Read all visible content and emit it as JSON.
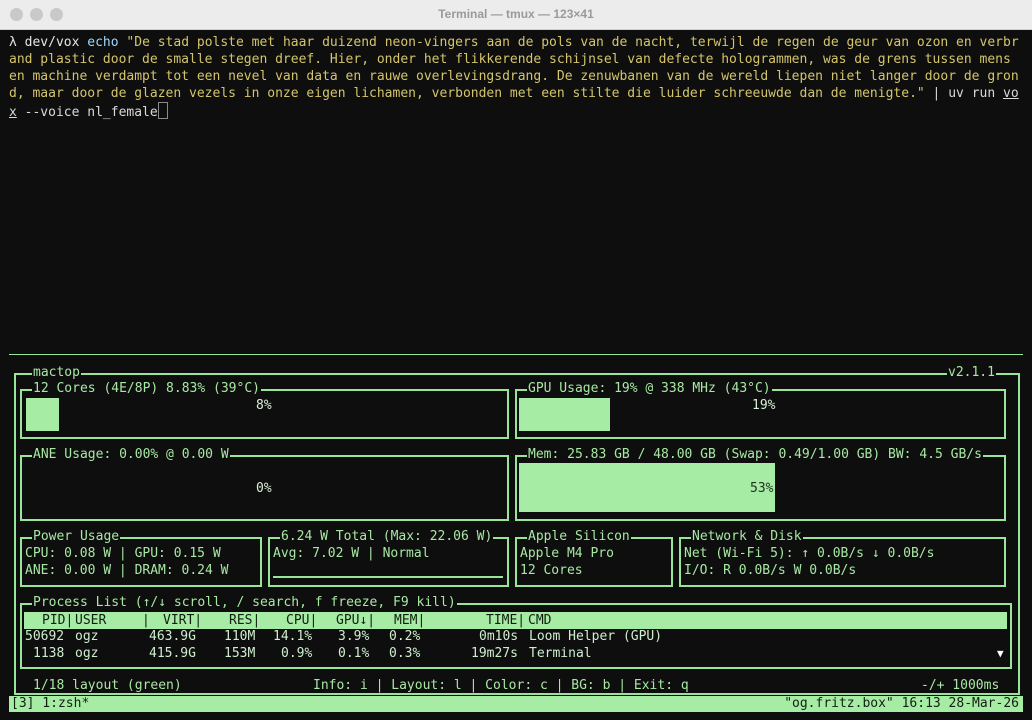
{
  "window": {
    "title": "Terminal — tmux — 123×41"
  },
  "shell": {
    "prompt": "λ dev/vox",
    "cmd_echo": "echo",
    "echo_text": "\"De stad polste met haar duizend neon-vingers aan de pols van de nacht, terwijl de regen de geur van ozon en verbrand plastic door de smalle stegen dreef. Hier, onder het flikkerende schijnsel van defecte hologrammen, was de grens tussen mens en machine verdampt tot een nevel van data en rauwe overlevingsdrang. De zenuwbanen van de wereld liepen niet langer door de grond, maar door de glazen vezels in onze eigen lichamen, verbonden met een stilte die luider schreeuwde dan de menigte.\"",
    "pipe": " | uv run ",
    "cmd_vox": "vox",
    "args": " --voice nl_female"
  },
  "mactop": {
    "name": "mactop",
    "version": "v2.1.1",
    "cpu": {
      "label": "12 Cores (4E/8P) 8.83% (39°C)",
      "percent_text": "8%",
      "usage": 0.0883
    },
    "gpu": {
      "label": "GPU Usage: 19% @ 338 MHz (43°C)",
      "percent_text": "19%",
      "usage": 0.19
    },
    "ane": {
      "label": "ANE Usage: 0.00% @ 0.00 W",
      "percent_text": "0%",
      "usage": 0
    },
    "mem": {
      "label": "Mem: 25.83 GB / 48.00 GB (Swap: 0.49/1.00 GB) BW: 4.5 GB/s",
      "percent_text": "53%",
      "usage": 0.53
    },
    "power": {
      "label": "Power Usage",
      "line1": "CPU: 0.08 W | GPU: 0.15 W",
      "line2": "ANE: 0.00 W | DRAM: 0.24 W"
    },
    "total": {
      "label": "6.24 W Total (Max: 22.06 W)",
      "line1": "Avg: 7.02 W | Normal"
    },
    "silicon": {
      "label": "Apple Silicon",
      "line1": "Apple M4 Pro",
      "line2": "12 Cores"
    },
    "network": {
      "label": "Network & Disk",
      "line1": "Net (Wi-Fi 5): ↑ 0.0B/s ↓ 0.0B/s",
      "line2": "I/O: R 0.0B/s W 0.0B/s"
    },
    "processes": {
      "label": "Process List (↑/↓ scroll, / search, f freeze, F9 kill)",
      "columns": [
        "PID|",
        "USER",
        "|",
        "VIRT|",
        "RES|",
        "CPU|",
        "GPU↓|",
        "MEM|",
        "TIME|",
        "CMD"
      ],
      "rows": [
        {
          "pid": "50692",
          "user": "ogz",
          "virt": "463.9G",
          "res": "110M",
          "cpu": "14.1%",
          "gpu": "3.9%",
          "mem": "0.2%",
          "time": "0m10s",
          "cmd": "Loom Helper (GPU)"
        },
        {
          "pid": "1138",
          "user": "ogz",
          "virt": "415.9G",
          "res": "153M",
          "cpu": "0.9%",
          "gpu": "0.1%",
          "mem": "0.3%",
          "time": "19m27s",
          "cmd": "Terminal"
        }
      ],
      "scroll_indicator": "▼"
    },
    "footer": {
      "layout": "1/18 layout (green)",
      "keys": "Info: i | Layout: l | Color: c | BG: b | Exit: q",
      "interval": "-/+ 1000ms"
    }
  },
  "tmux": {
    "window": "[3] 1:zsh*",
    "right": "\"og.fritz.box\" 16:13 28-Mar-26"
  }
}
